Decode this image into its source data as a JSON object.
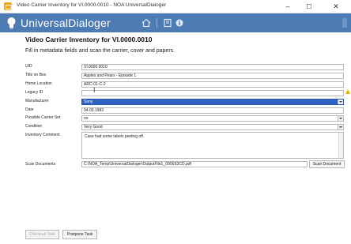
{
  "window": {
    "title": "Video Carrier Inventory for VI.0000.0010 - NOA UniversalDialoger",
    "minimize": "–",
    "maximize": "☐",
    "close": "✕"
  },
  "toolbar": {
    "app_name": "UniversalDialoger",
    "brand_color": "#4d7bb4",
    "icons": [
      "home-icon",
      "book-icon",
      "info-icon"
    ]
  },
  "form": {
    "title": "Video Carrier Inventory for VI.0000.0010",
    "subtitle": "Fill in metadata fields and scan the carrier, cover and papers.",
    "fields": {
      "uid": {
        "label": "UID",
        "value": "VI.0000.0010"
      },
      "title_on_box": {
        "label": "Title on Box",
        "value": "Apples and Pears - Episode 1"
      },
      "home_location": {
        "label": "Home Location",
        "value": "ARC-01-C-2"
      },
      "legacy_id": {
        "label": "Legacy ID",
        "value": ""
      },
      "manufacturer": {
        "label": "Manufacturer",
        "value": "Sony"
      },
      "date": {
        "label": "Date",
        "value": "04.03.1983"
      },
      "possible_carrier_set": {
        "label": "Possible Carrier Set",
        "value": "no"
      },
      "condition": {
        "label": "Condition",
        "value": "Very Good"
      },
      "inventory_comment": {
        "label": "Inventory Comment",
        "value": "Case had some labels peeling off."
      }
    },
    "scan": {
      "label": "Scan Documents",
      "path": "C:\\NOA_Temp\\UniversalDialoger\\OutputFile1_000E63CD.pdf",
      "button": "Scan Document"
    }
  },
  "footer": {
    "checkout_label": "Checkout Task",
    "postpone_label": "Postpone Task"
  }
}
